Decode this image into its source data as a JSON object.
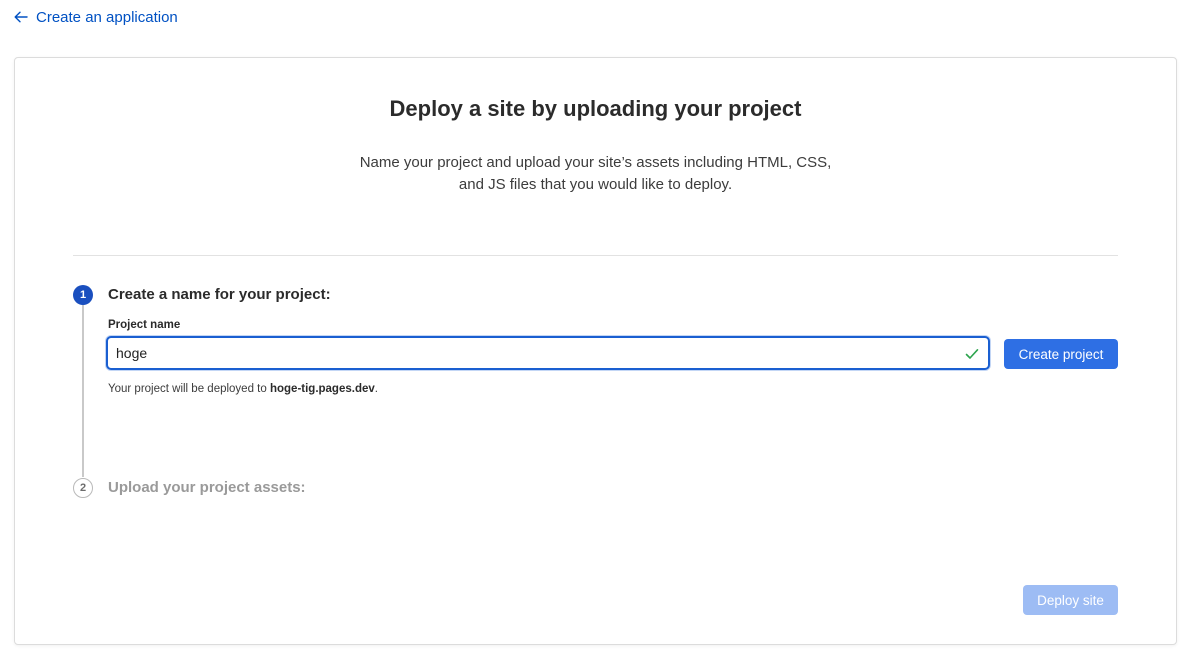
{
  "header": {
    "back_label": "Create an application"
  },
  "page": {
    "title": "Deploy a site by uploading your project",
    "subtitle_line1": "Name your project and upload your site’s assets including HTML, CSS,",
    "subtitle_line2": "and JS files that you would like to deploy."
  },
  "steps": [
    {
      "number": "1",
      "title": "Create a name for your project:",
      "state": "active"
    },
    {
      "number": "2",
      "title": "Upload your project assets:",
      "state": "pending"
    }
  ],
  "project_form": {
    "field_label": "Project name",
    "value": "hoge",
    "valid": true,
    "create_button_label": "Create project",
    "hint_prefix": "Your project will be deployed to ",
    "hint_domain": "hoge-tig.pages.dev",
    "hint_suffix": "."
  },
  "footer": {
    "deploy_button_label": "Deploy site",
    "deploy_enabled": false
  },
  "colors": {
    "link": "#0051c3",
    "primary_button": "#2e6fe4",
    "disabled_button": "#9dbcf4",
    "step_active": "#1a4fbf",
    "valid_check": "#2da44e"
  },
  "icons": {
    "back": "arrow-left-icon",
    "valid": "check-icon"
  }
}
